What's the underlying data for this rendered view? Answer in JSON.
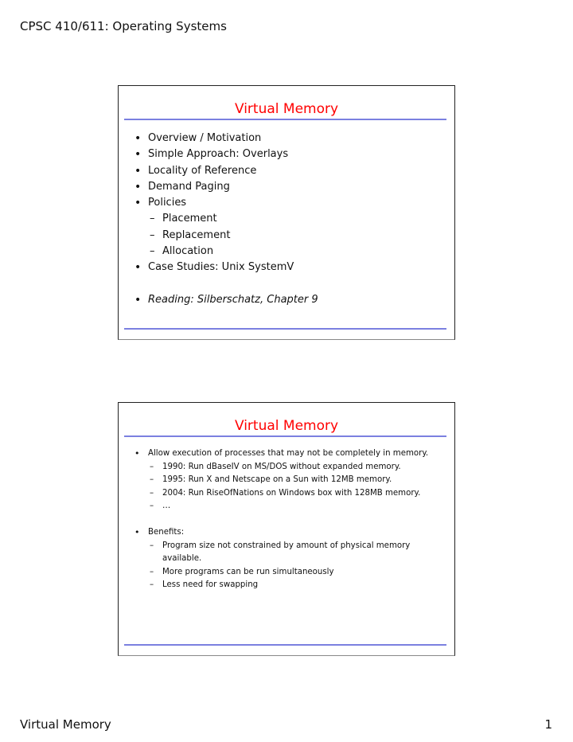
{
  "page": {
    "header": "CPSC 410/611: Operating Systems",
    "footer_title": "Virtual Memory",
    "page_number": "1"
  },
  "slides": [
    {
      "title": "Virtual Memory",
      "bullets": [
        {
          "level": 1,
          "text": "Overview / Motivation"
        },
        {
          "level": 1,
          "text": "Simple Approach: Overlays"
        },
        {
          "level": 1,
          "text": "Locality of Reference"
        },
        {
          "level": 1,
          "text": "Demand Paging"
        },
        {
          "level": 1,
          "text": "Policies"
        },
        {
          "level": 2,
          "text": "Placement"
        },
        {
          "level": 2,
          "text": "Replacement"
        },
        {
          "level": 2,
          "text": "Allocation"
        },
        {
          "level": 1,
          "text": "Case Studies: Unix SystemV"
        },
        {
          "level": 1,
          "text": "Reading: Silberschatz, Chapter 9",
          "italic": true
        }
      ]
    },
    {
      "title": "Virtual Memory",
      "bullets": [
        {
          "level": 1,
          "text": "Allow execution of processes that may not be completely in memory."
        },
        {
          "level": 2,
          "text": "1990: Run dBaseIV on MS/DOS without expanded memory."
        },
        {
          "level": 2,
          "text": "1995: Run X and Netscape on a Sun with 12MB memory."
        },
        {
          "level": 2,
          "text": "2004: Run RiseOfNations on Windows box with 128MB memory."
        },
        {
          "level": 2,
          "text": "…"
        },
        {
          "level": 1,
          "text": "Benefits:"
        },
        {
          "level": 2,
          "text": "Program size not constrained by amount of physical memory available."
        },
        {
          "level": 2,
          "text": "More programs can be run simultaneously"
        },
        {
          "level": 2,
          "text": "Less need for swapping"
        }
      ]
    }
  ]
}
